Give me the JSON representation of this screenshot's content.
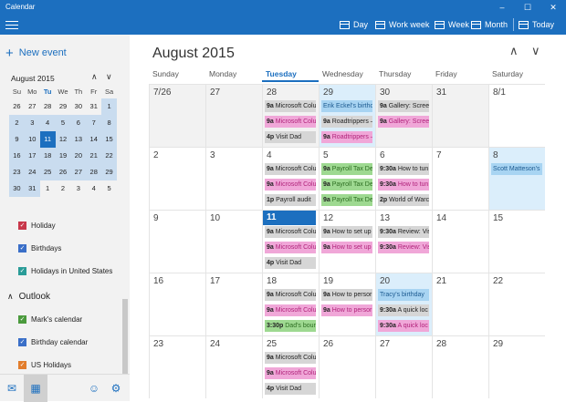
{
  "app": {
    "title": "Calendar"
  },
  "window_controls": {
    "minimize": "–",
    "maximize": "☐",
    "close": "✕"
  },
  "toolbar": {
    "day": "Day",
    "work_week": "Work week",
    "week": "Week",
    "month": "Month",
    "today": "Today"
  },
  "sidebar": {
    "new_event": "New event",
    "mini_month": "August 2015",
    "weekdays": [
      "Su",
      "Mo",
      "Tu",
      "We",
      "Th",
      "Fr",
      "Sa"
    ],
    "weeks": [
      [
        "26",
        "27",
        "28",
        "29",
        "30",
        "31",
        "1"
      ],
      [
        "2",
        "3",
        "4",
        "5",
        "6",
        "7",
        "8"
      ],
      [
        "9",
        "10",
        "11",
        "12",
        "13",
        "14",
        "15"
      ],
      [
        "16",
        "17",
        "18",
        "19",
        "20",
        "21",
        "22"
      ],
      [
        "23",
        "24",
        "25",
        "26",
        "27",
        "28",
        "29"
      ],
      [
        "30",
        "31",
        "1",
        "2",
        "3",
        "4",
        "5"
      ]
    ],
    "calendars": [
      {
        "label": "Holiday",
        "color": "#c8374a"
      },
      {
        "label": "Birthdays",
        "color": "#3a6fc8"
      },
      {
        "label": "Holidays in United States",
        "color": "#2a9c98"
      }
    ],
    "account": "Outlook",
    "outlook_calendars": [
      {
        "label": "Mark's calendar",
        "color": "#4b9a3d"
      },
      {
        "label": "Birthday calendar",
        "color": "#3a6fc8"
      },
      {
        "label": "US Holidays",
        "color": "#e27d2c"
      }
    ]
  },
  "main": {
    "month_title": "August 2015",
    "days_of_week": [
      "Sunday",
      "Monday",
      "Tuesday",
      "Wednesday",
      "Thursday",
      "Friday",
      "Saturday"
    ],
    "weeks": [
      [
        {
          "n": "7/26"
        },
        {
          "n": "27"
        },
        {
          "n": "28",
          "events": [
            {
              "t": "9a",
              "s": "Microsoft Colu",
              "c": "gray"
            },
            {
              "t": "9a",
              "s": "Microsoft Colu",
              "c": "pink"
            },
            {
              "t": "4p",
              "s": "Visit Dad",
              "c": "gray"
            }
          ]
        },
        {
          "n": "29",
          "events": [
            {
              "t": "",
              "s": "Erik Eckel's birthd",
              "c": "lblue"
            },
            {
              "t": "9a",
              "s": "Roadtrippers –",
              "c": "gray"
            },
            {
              "t": "9a",
              "s": "Roadtrippers –",
              "c": "pink"
            }
          ]
        },
        {
          "n": "30",
          "events": [
            {
              "t": "9a",
              "s": "Gallery: Screer",
              "c": "gray"
            },
            {
              "t": "9a",
              "s": "Gallery: Screer",
              "c": "pink"
            }
          ]
        },
        {
          "n": "31"
        },
        {
          "n": "8/1"
        }
      ],
      [
        {
          "n": "2"
        },
        {
          "n": "3"
        },
        {
          "n": "4",
          "events": [
            {
              "t": "9a",
              "s": "Microsoft Colu",
              "c": "gray"
            },
            {
              "t": "9a",
              "s": "Microsoft Colu",
              "c": "pink"
            },
            {
              "t": "1p",
              "s": "Payroll audit",
              "c": "gray"
            }
          ]
        },
        {
          "n": "5",
          "events": [
            {
              "t": "9a",
              "s": "Payroll Tax Dep",
              "c": "green"
            },
            {
              "t": "9a",
              "s": "Payroll Tax Dep",
              "c": "green"
            },
            {
              "t": "9a",
              "s": "Payroll Tax Dep",
              "c": "green"
            }
          ]
        },
        {
          "n": "6",
          "events": [
            {
              "t": "9:30a",
              "s": "How to tun",
              "c": "gray"
            },
            {
              "t": "9:30a",
              "s": "How to tun",
              "c": "pink"
            },
            {
              "t": "2p",
              "s": "World of Warc",
              "c": "gray"
            }
          ]
        },
        {
          "n": "7"
        },
        {
          "n": "8",
          "events": [
            {
              "t": "",
              "s": "Scott Matteson's I",
              "c": "lblue"
            }
          ]
        }
      ],
      [
        {
          "n": "9"
        },
        {
          "n": "10"
        },
        {
          "n": "11",
          "events": [
            {
              "t": "9a",
              "s": "Microsoft Colu",
              "c": "gray"
            },
            {
              "t": "9a",
              "s": "Microsoft Colu",
              "c": "pink"
            },
            {
              "t": "4p",
              "s": "Visit Dad",
              "c": "gray"
            }
          ]
        },
        {
          "n": "12",
          "events": [
            {
              "t": "9a",
              "s": "How to set up",
              "c": "gray"
            },
            {
              "t": "9a",
              "s": "How to set up",
              "c": "pink"
            }
          ]
        },
        {
          "n": "13",
          "events": [
            {
              "t": "9:30a",
              "s": "Review: Vis",
              "c": "gray"
            },
            {
              "t": "9:30a",
              "s": "Review: Vis",
              "c": "pink"
            }
          ]
        },
        {
          "n": "14"
        },
        {
          "n": "15"
        }
      ],
      [
        {
          "n": "16"
        },
        {
          "n": "17"
        },
        {
          "n": "18",
          "events": [
            {
              "t": "9a",
              "s": "Microsoft Colu",
              "c": "gray"
            },
            {
              "t": "9a",
              "s": "Microsoft Colu",
              "c": "pink"
            },
            {
              "t": "3:30p",
              "s": "Dad's bour",
              "c": "green"
            }
          ]
        },
        {
          "n": "19",
          "events": [
            {
              "t": "9a",
              "s": "How to persor",
              "c": "gray"
            },
            {
              "t": "9a",
              "s": "How to persor",
              "c": "pink"
            }
          ]
        },
        {
          "n": "20",
          "events": [
            {
              "t": "",
              "s": "Tracy's birthday",
              "c": "lblue"
            },
            {
              "t": "9:30a",
              "s": "A quick loc",
              "c": "gray"
            },
            {
              "t": "9:30a",
              "s": "A quick loc",
              "c": "pink"
            }
          ]
        },
        {
          "n": "21"
        },
        {
          "n": "22"
        }
      ],
      [
        {
          "n": "23"
        },
        {
          "n": "24"
        },
        {
          "n": "25",
          "events": [
            {
              "t": "9a",
              "s": "Microsoft Colu",
              "c": "gray"
            },
            {
              "t": "9a",
              "s": "Microsoft Colu",
              "c": "pink"
            },
            {
              "t": "4p",
              "s": "Visit Dad",
              "c": "gray"
            }
          ]
        },
        {
          "n": "26"
        },
        {
          "n": "27"
        },
        {
          "n": "28"
        },
        {
          "n": "29"
        }
      ]
    ]
  }
}
